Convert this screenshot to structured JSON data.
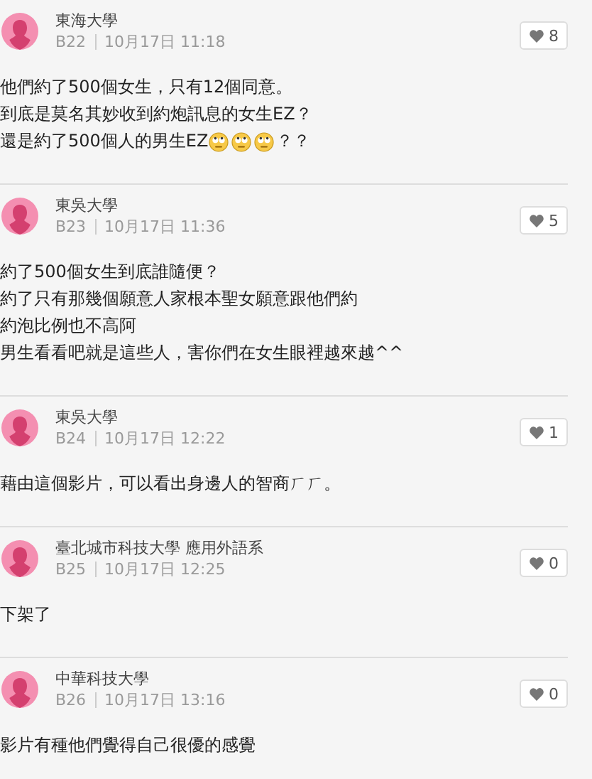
{
  "posts": [
    {
      "school": "東海大學",
      "floor": "B22",
      "time": "10月17日 11:18",
      "likes": "8",
      "lines": [
        [
          {
            "kind": "text",
            "text": "他們約了500個女生，只有12個同意。"
          }
        ],
        [
          {
            "kind": "text",
            "text": "到底是莫名其妙收到約炮訊息的女生EZ？"
          }
        ],
        [
          {
            "kind": "text",
            "text": "還是約了500個人的男生EZ"
          },
          {
            "kind": "emoji"
          },
          {
            "kind": "emoji"
          },
          {
            "kind": "emoji"
          },
          {
            "kind": "text",
            "text": " ？？"
          }
        ]
      ]
    },
    {
      "school": "東吳大學",
      "floor": "B23",
      "time": "10月17日 11:36",
      "likes": "5",
      "lines": [
        [
          {
            "kind": "text",
            "text": "約了500個女生到底誰隨便？"
          }
        ],
        [
          {
            "kind": "text",
            "text": "約了只有那幾個願意人家根本聖女願意跟他們約"
          }
        ],
        [
          {
            "kind": "text",
            "text": "約泡比例也不高阿"
          }
        ],
        [
          {
            "kind": "text",
            "text": "男生看看吧就是這些人，害你們在女生眼裡越來越^^"
          }
        ]
      ]
    },
    {
      "school": "東吳大學",
      "floor": "B24",
      "time": "10月17日 12:22",
      "likes": "1",
      "lines": [
        [
          {
            "kind": "text",
            "text": "藉由這個影片，可以看出身邊人的智商ㄏㄏ。"
          }
        ]
      ]
    },
    {
      "school": "臺北城市科技大學 應用外語系",
      "floor": "B25",
      "time": "10月17日 12:25",
      "likes": "0",
      "lines": [
        [
          {
            "kind": "text",
            "text": "下架了"
          }
        ]
      ]
    },
    {
      "school": "中華科技大學",
      "floor": "B26",
      "time": "10月17日 13:16",
      "likes": "0",
      "lines": [
        [
          {
            "kind": "text",
            "text": "影片有種他們覺得自己很優的感覺"
          }
        ]
      ]
    }
  ]
}
